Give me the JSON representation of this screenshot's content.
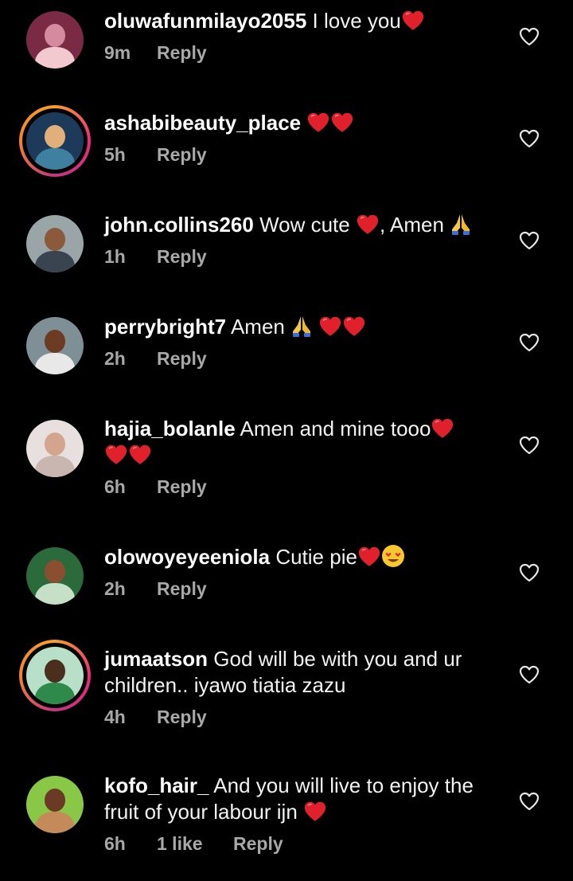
{
  "comments": [
    {
      "username": "oluwafunmilayo2055",
      "text": "I love you",
      "time": "9m",
      "reply": "Reply",
      "avatar_colors": [
        "#7a2a45",
        "#d58aa0",
        "#f2c9cf"
      ]
    },
    {
      "username": "ashabibeauty_place",
      "text": "",
      "time": "5h",
      "reply": "Reply",
      "avatar_colors": [
        "#1e3a5a",
        "#e1b07a",
        "#3f7f9f"
      ]
    },
    {
      "username": "john.collins260",
      "text": "Wow cute",
      "text2": ", Amen",
      "time": "1h",
      "reply": "Reply",
      "avatar_colors": [
        "#9aa5a8",
        "#8a5a3a",
        "#3a4450"
      ]
    },
    {
      "username": "perrybright7",
      "text": "Amen",
      "time": "2h",
      "reply": "Reply",
      "avatar_colors": [
        "#7e8f96",
        "#6b3b24",
        "#e8e8e8"
      ]
    },
    {
      "username": "hajia_bolanle",
      "text": "Amen and mine tooo",
      "time": "6h",
      "reply": "Reply",
      "avatar_colors": [
        "#e8e0de",
        "#d3a58e",
        "#c9b6b0"
      ]
    },
    {
      "username": "olowoyeyeeniola",
      "text": "Cutie pie",
      "time": "2h",
      "reply": "Reply",
      "avatar_colors": [
        "#2b6a3a",
        "#8a4e30",
        "#c6e0c8"
      ]
    },
    {
      "username": "jumaatson",
      "text": "God will be with you and ur children.. iyawo tiatia zazu",
      "time": "4h",
      "reply": "Reply",
      "avatar_colors": [
        "#b8e0c8",
        "#4a2e1e",
        "#2e8a4a"
      ]
    },
    {
      "username": "kofo_hair_",
      "text": "And you will live to enjoy the fruit of your labour ijn",
      "time": "6h",
      "likes": "1 like",
      "reply": "Reply",
      "avatar_colors": [
        "#88c846",
        "#6a3a24",
        "#c48a5a"
      ]
    }
  ],
  "icons": {
    "like": "heart-outline-icon",
    "red_heart": "red-heart-emoji",
    "pray": "folded-hands-emoji",
    "heart_eyes": "heart-eyes-emoji"
  },
  "colors": {
    "background": "#000000",
    "text": "#f2f2f2",
    "secondary": "#a8a8a8",
    "heart": "#e0202a"
  }
}
